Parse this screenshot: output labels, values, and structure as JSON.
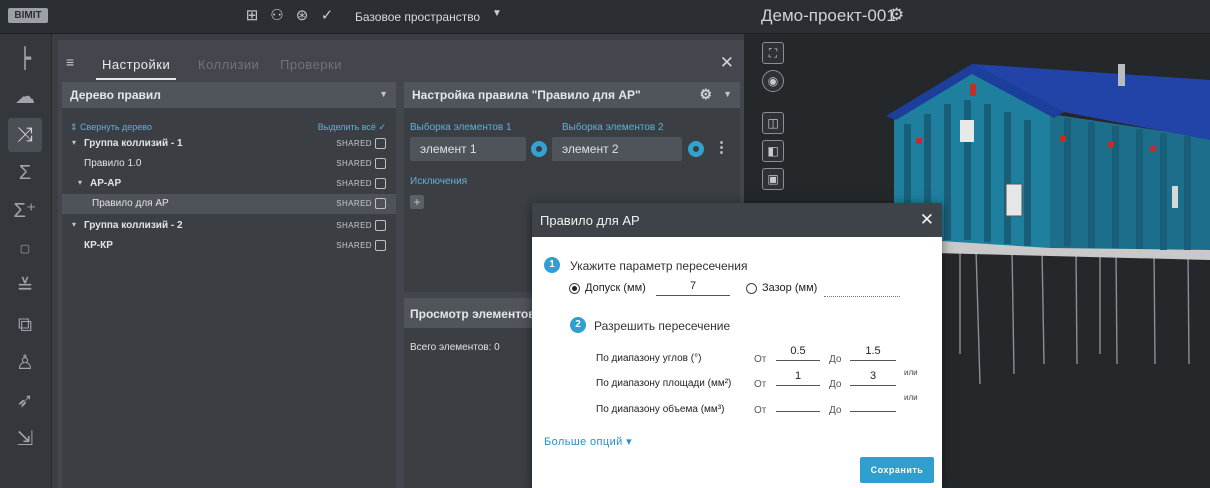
{
  "topbar": {
    "logo": "BIMIT",
    "icons": [
      "hierarchy-icon",
      "people-icon",
      "security-icon",
      "check-circle-icon"
    ],
    "space_label": "Базовое пространство",
    "project_title": "Демо-проект-001"
  },
  "rail": {
    "items": [
      "tree-icon",
      "cloud-icon",
      "collision-icon",
      "sigma-icon",
      "sigma-plus-icon",
      "2d-icon",
      "measure-icon",
      "puzzle-icon",
      "users-icon",
      "send-icon",
      "export-icon"
    ]
  },
  "panel": {
    "tabs": [
      {
        "label": "Настройки",
        "active": true
      },
      {
        "label": "Коллизии",
        "active": false
      },
      {
        "label": "Проверки",
        "active": false
      }
    ]
  },
  "tree": {
    "title": "Дерево правил",
    "collapse_label": "Свернуть дерево",
    "select_all_label": "Выделить всё",
    "shared_label": "SHARED",
    "rows": [
      {
        "label": "Группа коллизий - 1",
        "bold": true
      },
      {
        "label": "Правило 1.0",
        "bold": false
      },
      {
        "label": "АР-АР",
        "bold": true
      },
      {
        "label": "Правило для АР",
        "bold": false
      },
      {
        "label": "Группа коллизий - 2",
        "bold": true
      },
      {
        "label": "КР-КР",
        "bold": true
      }
    ]
  },
  "settings": {
    "title": "Настройка правила \"Правило для АР\"",
    "selection1_label": "Выборка элементов 1",
    "selection2_label": "Выборка элементов 2",
    "selection1_value": "элемент 1",
    "selection2_value": "элемент 2",
    "exclusions_label": "Исключения"
  },
  "view": {
    "title": "Просмотр элементов",
    "total": "Всего элементов: 0"
  },
  "dialog": {
    "title": "Правило для АР",
    "step1_num": "1",
    "step1_text": "Укажите параметр пересечения",
    "tolerance_label": "Допуск (мм)",
    "tolerance_value": "7",
    "gap_label": "Зазор (мм)",
    "step2_num": "2",
    "step2_text": "Разрешить пересечение",
    "from_label": "От",
    "to_label": "До",
    "or_label": "или",
    "rows": [
      {
        "label": "По диапазону углов (°)",
        "from": "0.5",
        "to": "1.5"
      },
      {
        "label": "По диапазону площади (мм²)",
        "from": "1",
        "to": "3"
      },
      {
        "label": "По диапазону объема (мм³)",
        "from": "",
        "to": ""
      }
    ],
    "more_options": "Больше опций",
    "save_label": "Сохранить"
  },
  "colors": {
    "accent": "#2f9fd0",
    "link": "#62b0d8",
    "background": "#3b3f44"
  }
}
